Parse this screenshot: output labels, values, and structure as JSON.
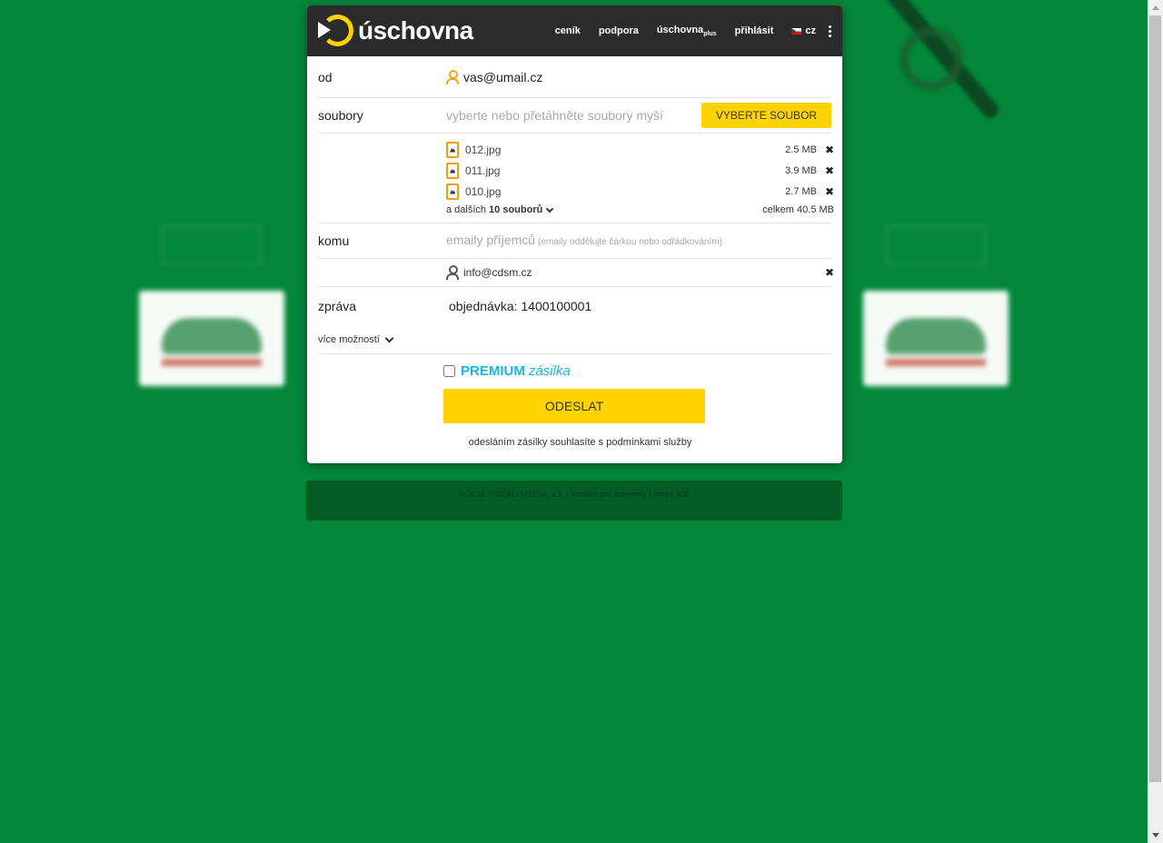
{
  "brand": {
    "name": "úschovna",
    "accent": "#ffd300",
    "bg": "#03873a"
  },
  "nav": {
    "items": [
      "ceník",
      "podpora"
    ],
    "plus_main": "úschovna",
    "plus_sub": "plus",
    "login": "přihlásit",
    "lang": "cz"
  },
  "form": {
    "from_label": "od",
    "from_value": "vas@umail.cz",
    "files_label": "soubory",
    "files_placeholder": "vyberte nebo přetáhněte soubory myší",
    "select_button": "VYBERTE SOUBOR",
    "files": [
      {
        "name": "012.jpg",
        "size": "2.5 MB"
      },
      {
        "name": "011.jpg",
        "size": "3.9 MB"
      },
      {
        "name": "010.jpg",
        "size": "2.7 MB"
      }
    ],
    "more_prefix": "a dalších",
    "more_count": "10 souborů",
    "total": "celkem 40.5 MB",
    "to_label": "komu",
    "to_placeholder": "emaily příjemců",
    "to_hint": "(emaily oddělujte čárkou nebo odřádkováním)",
    "recipient": "info@cdsm.cz",
    "message_label": "zpráva",
    "message_value": "objednávka: 1400100001",
    "more_options": "více možností",
    "premium_a": "PREMIUM",
    "premium_b": "zásilka",
    "send": "ODESLAT",
    "terms": "odesláním zásilky souhlasíte s podmínkami služby"
  },
  "footer": {
    "copyright": "© 2016 TISCALI MEDIA, a.s.",
    "contact": "kontakt pro inzerenty",
    "version": "verze 902"
  }
}
